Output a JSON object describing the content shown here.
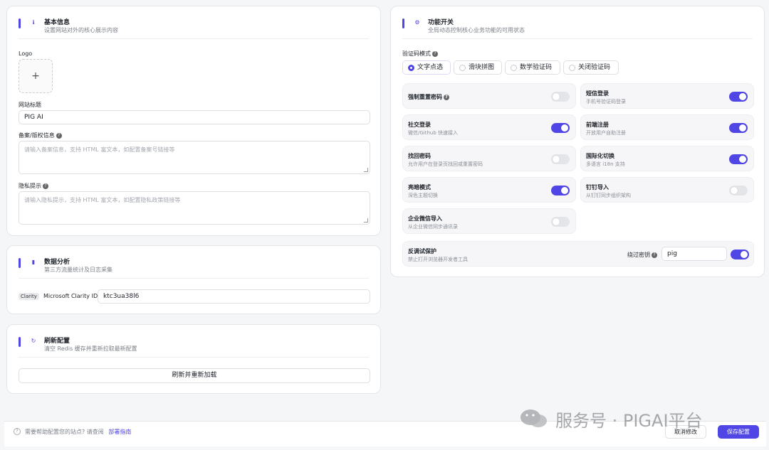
{
  "basic": {
    "title": "基本信息",
    "subtitle": "设置网站对外的核心展示内容",
    "logo_label": "Logo",
    "upload_glyph": "+",
    "site_title_label": "网站标题",
    "site_title_value": "PIG AI",
    "icp_label": "备案/版权信息",
    "icp_placeholder": "请输入备案信息，支持 HTML 富文本，如配置备案号链接等",
    "privacy_label": "隐私提示",
    "privacy_placeholder": "请输入隐私提示，支持 HTML 富文本，如配置隐私政策链接等",
    "icon": "info-icon"
  },
  "analytics": {
    "title": "数据分析",
    "subtitle": "第三方流量统计及日志采集",
    "clarity_tag": "Clarity",
    "clarity_label": "Microsoft Clarity ID",
    "clarity_value": "ktc3ua38l6",
    "icon": "bar-chart-icon"
  },
  "refresh": {
    "title": "刷新配置",
    "subtitle": "清空 Redis 缓存并重新拉取最新配置",
    "button": "刷新并重新加载",
    "icon": "refresh-icon"
  },
  "features": {
    "title": "功能开关",
    "subtitle": "全局动态控制核心业务功能的可用状态",
    "icon": "gear-icon",
    "captcha_label": "验证码模式",
    "captcha_options": [
      "文字点选",
      "滑块拼图",
      "数学验证码",
      "关闭验证码"
    ],
    "captcha_selected": "文字点选",
    "items": [
      {
        "title": "强制重置密码",
        "desc": "",
        "on": false,
        "help": true
      },
      {
        "title": "短信登录",
        "desc": "手机号验证码登录",
        "on": true
      },
      {
        "title": "社交登录",
        "desc": "微信/Github 快速接入",
        "on": true
      },
      {
        "title": "前端注册",
        "desc": "开放用户自助注册",
        "on": true
      },
      {
        "title": "找回密码",
        "desc": "允许用户在登录页找回或重置密码",
        "on": false
      },
      {
        "title": "国际化切换",
        "desc": "多语言 i18n 支持",
        "on": true
      },
      {
        "title": "亮暗模式",
        "desc": "深色主题切换",
        "on": true
      },
      {
        "title": "钉钉导入",
        "desc": "从钉钉同步组织架构",
        "on": false
      },
      {
        "title": "企业微信导入",
        "desc": "从企业微信同步通讯录",
        "on": false
      }
    ],
    "anti_debug": {
      "title": "反调试保护",
      "desc": "禁止打开浏览器开发者工具",
      "bypass_label": "绕过密钥",
      "bypass_value": "pig",
      "on": true
    }
  },
  "footer": {
    "help_text": "需要帮助配置您的站点? 请查阅",
    "help_link": "部署指南",
    "cancel": "取消修改",
    "save": "保存配置"
  },
  "watermark": "服务号 · PIGAI平台",
  "colors": {
    "accent": "#4f46e5",
    "toggle_off": "#e4e5e8"
  }
}
